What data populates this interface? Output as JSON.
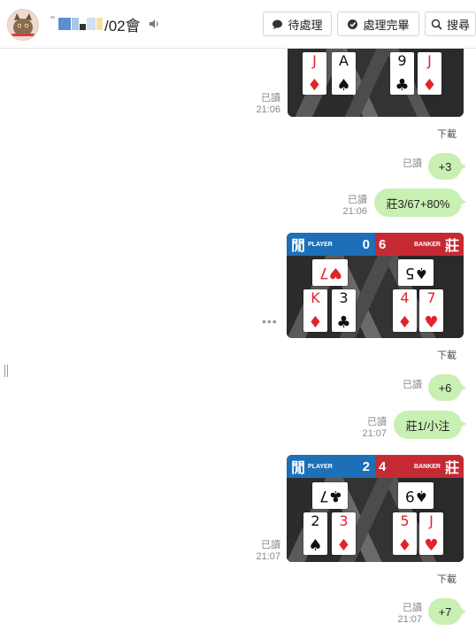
{
  "header": {
    "title_suffix": "/02會",
    "buttons": {
      "pending": "待處理",
      "done": "處理完畢",
      "search": "搜尋"
    }
  },
  "colors": {
    "bubble": "#c9f0b3",
    "player_blue": "#1d6fb8",
    "banker_red": "#c52a33"
  },
  "messages": {
    "img1": {
      "read": "已讀",
      "time": "21:06",
      "download": "下載"
    },
    "m1": {
      "read": "已讀",
      "text": "+3"
    },
    "m2": {
      "read": "已讀",
      "time": "21:06",
      "text": "莊3/67+80%"
    },
    "img2": {
      "download": "下載",
      "player_han": "閒",
      "player_label": "PLAYER",
      "player_score": "0",
      "banker_score": "6",
      "banker_label": "BANKER",
      "banker_han": "莊"
    },
    "m3": {
      "read": "已讀",
      "text": "+6"
    },
    "m4": {
      "read": "已讀",
      "time": "21:07",
      "text": "莊1/小注"
    },
    "img3": {
      "read": "已讀",
      "time": "21:07",
      "download": "下載",
      "player_han": "閒",
      "player_label": "PLAYER",
      "player_score": "2",
      "banker_score": "4",
      "banker_label": "BANKER",
      "banker_han": "莊"
    },
    "m5": {
      "read": "已讀",
      "time": "21:07",
      "text": "+7"
    }
  },
  "cards": {
    "img1": [
      {
        "rank": "J",
        "suit": "♦"
      },
      {
        "rank": "A",
        "suit": "♠"
      },
      {
        "rank": "9",
        "suit": "♣"
      },
      {
        "rank": "J",
        "suit": "♦"
      }
    ],
    "img2": [
      {
        "rank": "7",
        "suit": "♥"
      },
      {
        "rank": "K",
        "suit": "♦"
      },
      {
        "rank": "3",
        "suit": "♣"
      },
      {
        "rank": "5",
        "suit": "♠"
      },
      {
        "rank": "4",
        "suit": "♦"
      },
      {
        "rank": "7",
        "suit": "♥"
      }
    ],
    "img3": [
      {
        "rank": "7",
        "suit": "♣"
      },
      {
        "rank": "2",
        "suit": "♠"
      },
      {
        "rank": "3",
        "suit": "♦"
      },
      {
        "rank": "9",
        "suit": "♠"
      },
      {
        "rank": "5",
        "suit": "♦"
      },
      {
        "rank": "J",
        "suit": "♥"
      }
    ]
  }
}
